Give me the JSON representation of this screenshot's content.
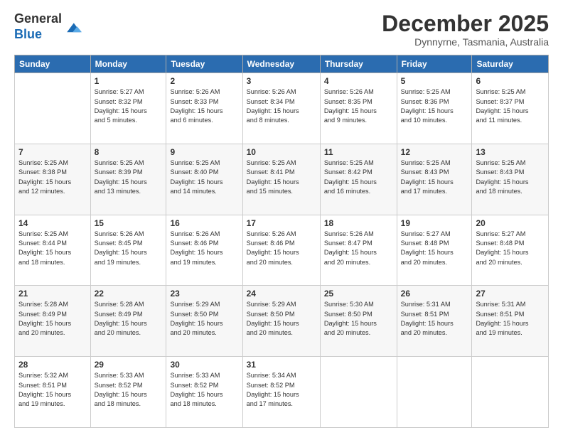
{
  "header": {
    "logo_line1": "General",
    "logo_line2": "Blue",
    "month_title": "December 2025",
    "location": "Dynnyrne, Tasmania, Australia"
  },
  "days_of_week": [
    "Sunday",
    "Monday",
    "Tuesday",
    "Wednesday",
    "Thursday",
    "Friday",
    "Saturday"
  ],
  "weeks": [
    [
      {
        "day": "",
        "info": ""
      },
      {
        "day": "1",
        "info": "Sunrise: 5:27 AM\nSunset: 8:32 PM\nDaylight: 15 hours\nand 5 minutes."
      },
      {
        "day": "2",
        "info": "Sunrise: 5:26 AM\nSunset: 8:33 PM\nDaylight: 15 hours\nand 6 minutes."
      },
      {
        "day": "3",
        "info": "Sunrise: 5:26 AM\nSunset: 8:34 PM\nDaylight: 15 hours\nand 8 minutes."
      },
      {
        "day": "4",
        "info": "Sunrise: 5:26 AM\nSunset: 8:35 PM\nDaylight: 15 hours\nand 9 minutes."
      },
      {
        "day": "5",
        "info": "Sunrise: 5:25 AM\nSunset: 8:36 PM\nDaylight: 15 hours\nand 10 minutes."
      },
      {
        "day": "6",
        "info": "Sunrise: 5:25 AM\nSunset: 8:37 PM\nDaylight: 15 hours\nand 11 minutes."
      }
    ],
    [
      {
        "day": "7",
        "info": "Sunrise: 5:25 AM\nSunset: 8:38 PM\nDaylight: 15 hours\nand 12 minutes."
      },
      {
        "day": "8",
        "info": "Sunrise: 5:25 AM\nSunset: 8:39 PM\nDaylight: 15 hours\nand 13 minutes."
      },
      {
        "day": "9",
        "info": "Sunrise: 5:25 AM\nSunset: 8:40 PM\nDaylight: 15 hours\nand 14 minutes."
      },
      {
        "day": "10",
        "info": "Sunrise: 5:25 AM\nSunset: 8:41 PM\nDaylight: 15 hours\nand 15 minutes."
      },
      {
        "day": "11",
        "info": "Sunrise: 5:25 AM\nSunset: 8:42 PM\nDaylight: 15 hours\nand 16 minutes."
      },
      {
        "day": "12",
        "info": "Sunrise: 5:25 AM\nSunset: 8:43 PM\nDaylight: 15 hours\nand 17 minutes."
      },
      {
        "day": "13",
        "info": "Sunrise: 5:25 AM\nSunset: 8:43 PM\nDaylight: 15 hours\nand 18 minutes."
      }
    ],
    [
      {
        "day": "14",
        "info": "Sunrise: 5:25 AM\nSunset: 8:44 PM\nDaylight: 15 hours\nand 18 minutes."
      },
      {
        "day": "15",
        "info": "Sunrise: 5:26 AM\nSunset: 8:45 PM\nDaylight: 15 hours\nand 19 minutes."
      },
      {
        "day": "16",
        "info": "Sunrise: 5:26 AM\nSunset: 8:46 PM\nDaylight: 15 hours\nand 19 minutes."
      },
      {
        "day": "17",
        "info": "Sunrise: 5:26 AM\nSunset: 8:46 PM\nDaylight: 15 hours\nand 20 minutes."
      },
      {
        "day": "18",
        "info": "Sunrise: 5:26 AM\nSunset: 8:47 PM\nDaylight: 15 hours\nand 20 minutes."
      },
      {
        "day": "19",
        "info": "Sunrise: 5:27 AM\nSunset: 8:48 PM\nDaylight: 15 hours\nand 20 minutes."
      },
      {
        "day": "20",
        "info": "Sunrise: 5:27 AM\nSunset: 8:48 PM\nDaylight: 15 hours\nand 20 minutes."
      }
    ],
    [
      {
        "day": "21",
        "info": "Sunrise: 5:28 AM\nSunset: 8:49 PM\nDaylight: 15 hours\nand 20 minutes."
      },
      {
        "day": "22",
        "info": "Sunrise: 5:28 AM\nSunset: 8:49 PM\nDaylight: 15 hours\nand 20 minutes."
      },
      {
        "day": "23",
        "info": "Sunrise: 5:29 AM\nSunset: 8:50 PM\nDaylight: 15 hours\nand 20 minutes."
      },
      {
        "day": "24",
        "info": "Sunrise: 5:29 AM\nSunset: 8:50 PM\nDaylight: 15 hours\nand 20 minutes."
      },
      {
        "day": "25",
        "info": "Sunrise: 5:30 AM\nSunset: 8:50 PM\nDaylight: 15 hours\nand 20 minutes."
      },
      {
        "day": "26",
        "info": "Sunrise: 5:31 AM\nSunset: 8:51 PM\nDaylight: 15 hours\nand 20 minutes."
      },
      {
        "day": "27",
        "info": "Sunrise: 5:31 AM\nSunset: 8:51 PM\nDaylight: 15 hours\nand 19 minutes."
      }
    ],
    [
      {
        "day": "28",
        "info": "Sunrise: 5:32 AM\nSunset: 8:51 PM\nDaylight: 15 hours\nand 19 minutes."
      },
      {
        "day": "29",
        "info": "Sunrise: 5:33 AM\nSunset: 8:52 PM\nDaylight: 15 hours\nand 18 minutes."
      },
      {
        "day": "30",
        "info": "Sunrise: 5:33 AM\nSunset: 8:52 PM\nDaylight: 15 hours\nand 18 minutes."
      },
      {
        "day": "31",
        "info": "Sunrise: 5:34 AM\nSunset: 8:52 PM\nDaylight: 15 hours\nand 17 minutes."
      },
      {
        "day": "",
        "info": ""
      },
      {
        "day": "",
        "info": ""
      },
      {
        "day": "",
        "info": ""
      }
    ]
  ]
}
